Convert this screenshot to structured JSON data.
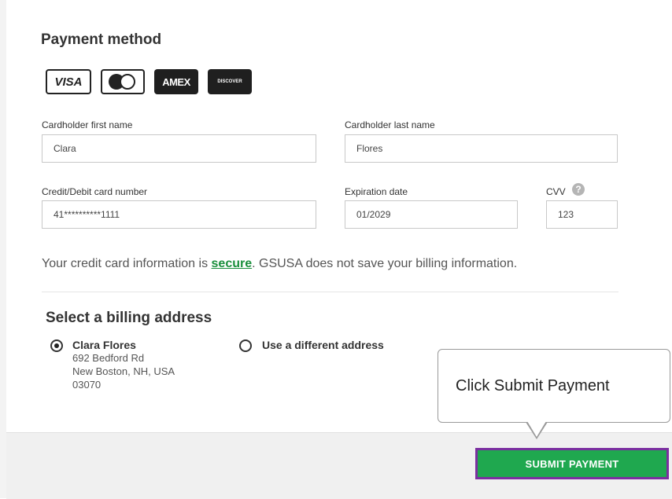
{
  "payment": {
    "title": "Payment method",
    "card_logos": {
      "visa": "VISA",
      "amex": "AMEX",
      "discover": "DISCOVER"
    },
    "first_name": {
      "label": "Cardholder first name",
      "value": "Clara"
    },
    "last_name": {
      "label": "Cardholder last name",
      "value": "Flores"
    },
    "card_number": {
      "label": "Credit/Debit card number",
      "value": "41**********1111"
    },
    "expiration": {
      "label": "Expiration date",
      "value": "01/2029"
    },
    "cvv": {
      "label": "CVV",
      "value": "123",
      "help": "?"
    },
    "secure_note": {
      "before": "Your credit card information is ",
      "link": "secure",
      "after": ". GSUSA does not save your billing information."
    }
  },
  "billing": {
    "title": "Select a billing address",
    "selected": {
      "name": "Clara Flores",
      "line1": "692 Bedford Rd",
      "line2": "New Boston, NH, USA",
      "line3": "03070"
    },
    "alternate_label": "Use a different address"
  },
  "actions": {
    "submit_label": "SUBMIT PAYMENT"
  },
  "callout": {
    "text": "Click Submit Payment"
  },
  "colors": {
    "submit_bg": "#1fa84f",
    "submit_border": "#7b2fa0",
    "link": "#1a8f3c"
  }
}
